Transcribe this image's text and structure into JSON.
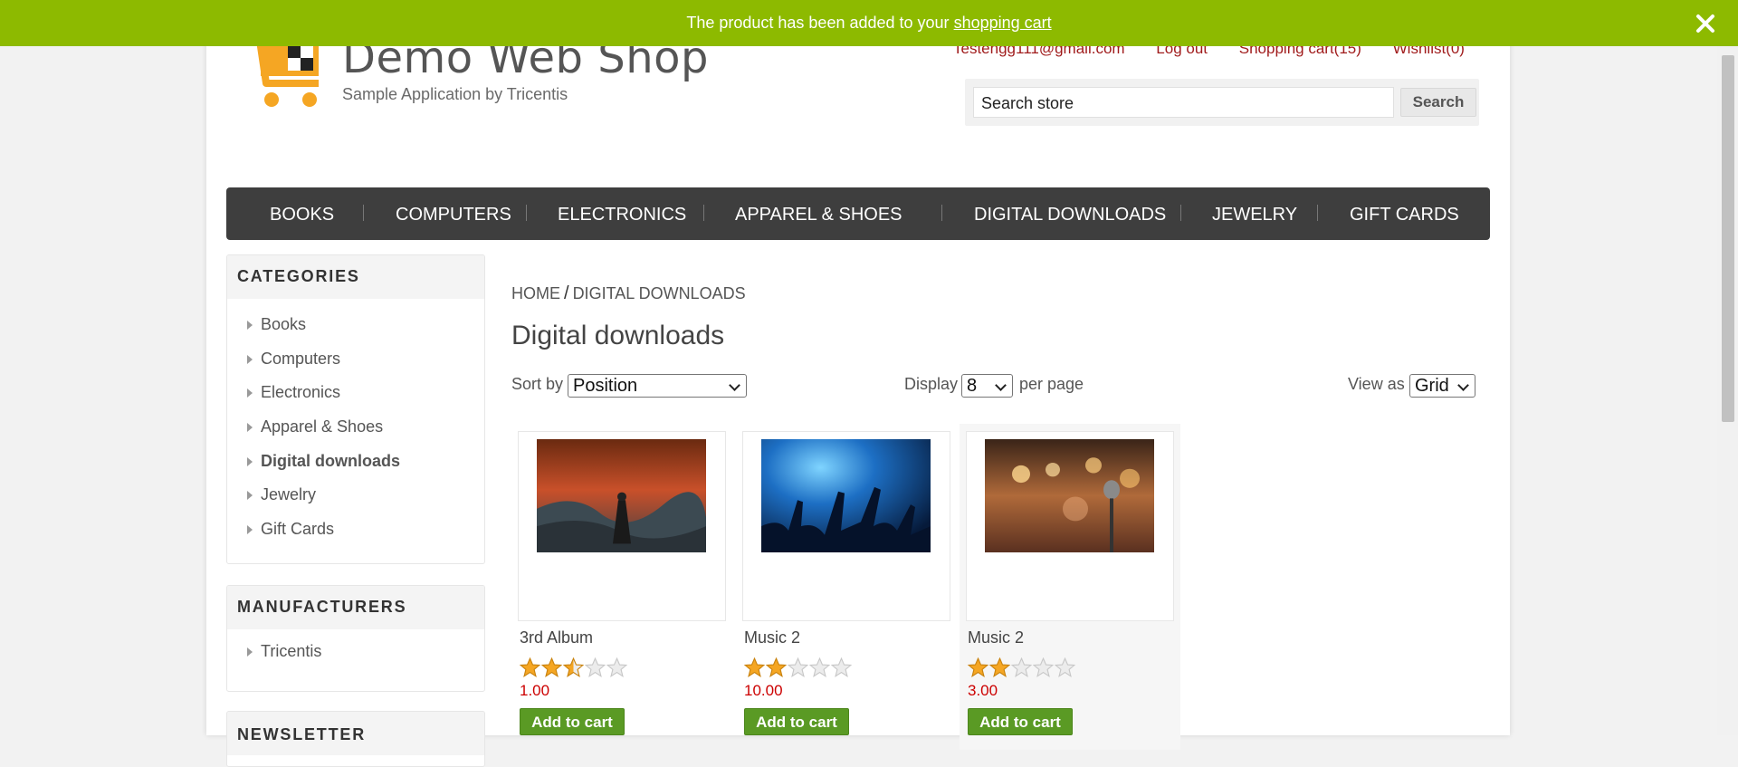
{
  "notification": {
    "text": "The product has been added to your",
    "link": "shopping cart",
    "close_icon": "close-icon"
  },
  "brand": {
    "title": "Demo Web Shop",
    "subtitle": "Sample Application by Tricentis",
    "logo_icon": "shopping-cart-logo"
  },
  "header": {
    "account": "Testengg111@gmail.com",
    "logout": "Log out",
    "cart": "Shopping cart(15)",
    "wishlist": "Wishlist(0)"
  },
  "search": {
    "value": "Search store",
    "button": "Search"
  },
  "nav": [
    "BOOKS",
    "COMPUTERS",
    "ELECTRONICS",
    "APPAREL & SHOES",
    "DIGITAL DOWNLOADS",
    "JEWELRY",
    "GIFT CARDS"
  ],
  "categories": {
    "title": "CATEGORIES",
    "items": [
      "Books",
      "Computers",
      "Electronics",
      "Apparel & Shoes",
      "Digital downloads",
      "Jewelry",
      "Gift Cards"
    ],
    "active": "Digital downloads"
  },
  "manufacturers": {
    "title": "MANUFACTURERS",
    "items": [
      "Tricentis"
    ]
  },
  "newsletter": {
    "title": "NEWSLETTER"
  },
  "breadcrumb": {
    "home": "HOME",
    "separator": "/",
    "current": "DIGITAL DOWNLOADS"
  },
  "page_title": "Digital downloads",
  "controls": {
    "sort_label": "Sort by",
    "sort_value": "Position",
    "display_label": "Display",
    "display_value": "8",
    "per_page": "per page",
    "view_label": "View as",
    "view_value": "Grid"
  },
  "products": [
    {
      "name": "3rd Album",
      "rating": 2.5,
      "price": "1.00",
      "button": "Add to cart",
      "image": "album-cover-image"
    },
    {
      "name": "Music 2",
      "rating": 2,
      "price": "10.00",
      "button": "Add to cart",
      "image": "concert-crowd-image"
    },
    {
      "name": "Music 2",
      "rating": 2,
      "price": "3.00",
      "button": "Add to cart",
      "image": "microphone-stage-image"
    }
  ],
  "colors": {
    "accent_green": "#8dba00",
    "nav_bg": "#3e3e3e",
    "price_red": "#cc0000",
    "link_red": "#a01c1c",
    "button_green": "#5a9a24",
    "star_gold": "#f5a623"
  }
}
